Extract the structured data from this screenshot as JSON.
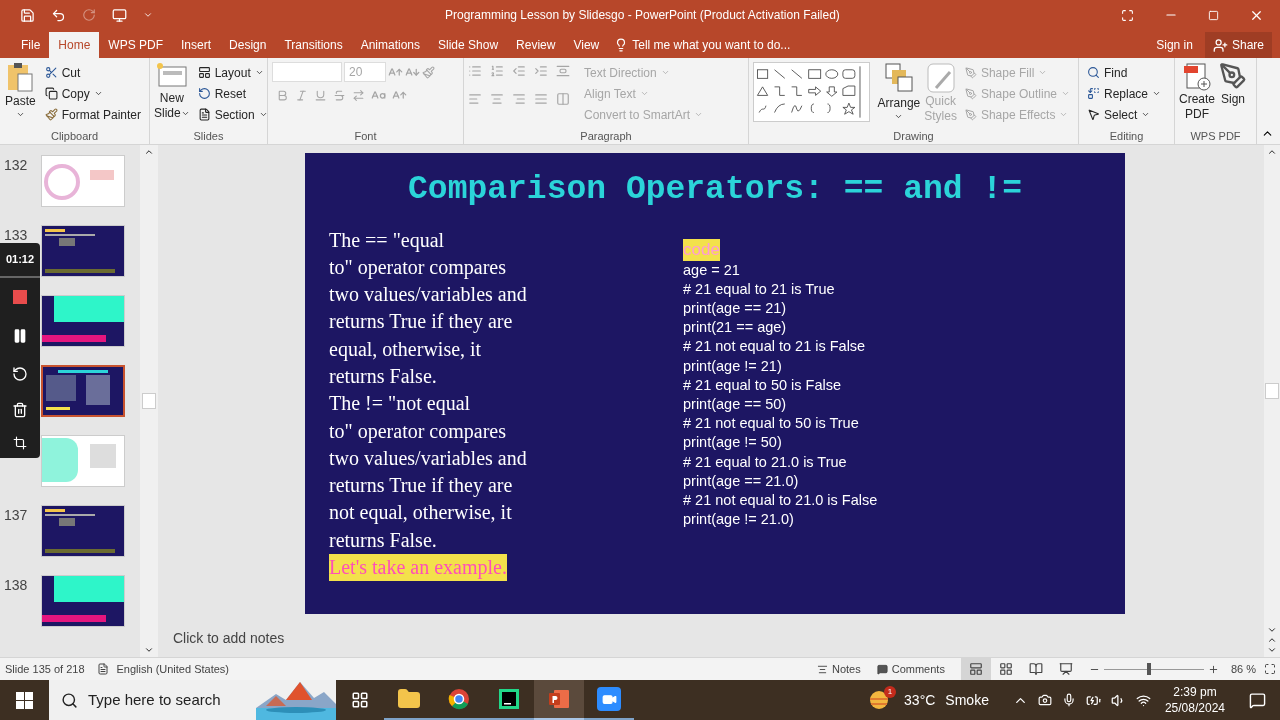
{
  "window": {
    "title": "Programming Lesson by Slidesgo - PowerPoint (Product Activation Failed)"
  },
  "menu_tabs": [
    {
      "label": "File",
      "selected": false
    },
    {
      "label": "Home",
      "selected": true
    },
    {
      "label": "WPS PDF",
      "selected": false
    },
    {
      "label": "Insert",
      "selected": false
    },
    {
      "label": "Design",
      "selected": false
    },
    {
      "label": "Transitions",
      "selected": false
    },
    {
      "label": "Animations",
      "selected": false
    },
    {
      "label": "Slide Show",
      "selected": false
    },
    {
      "label": "Review",
      "selected": false
    },
    {
      "label": "View",
      "selected": false
    }
  ],
  "tell_me": "Tell me what you want to do...",
  "sign_in": "Sign in",
  "share": "Share",
  "ribbon": {
    "clipboard": {
      "label": "Clipboard",
      "paste": "Paste",
      "items": [
        {
          "label": "Cut",
          "disabled": false
        },
        {
          "label": "Copy",
          "disabled": false
        },
        {
          "label": "Format Painter",
          "disabled": false
        }
      ]
    },
    "slides": {
      "label": "Slides",
      "new_slide": [
        "New",
        "Slide"
      ],
      "items": [
        {
          "label": "Layout",
          "disabled": false
        },
        {
          "label": "Reset",
          "disabled": false
        },
        {
          "label": "Section",
          "disabled": false
        }
      ]
    },
    "font": {
      "label": "Font",
      "size": "20"
    },
    "paragraph": {
      "label": "Paragraph",
      "items": [
        {
          "label": "Text Direction",
          "disabled": true
        },
        {
          "label": "Align Text",
          "disabled": true
        },
        {
          "label": "Convert to SmartArt",
          "disabled": true
        }
      ]
    },
    "drawing": {
      "label": "Drawing",
      "arrange": "Arrange",
      "quick_styles": [
        "Quick",
        "Styles"
      ],
      "items": [
        {
          "label": "Shape Fill",
          "disabled": true
        },
        {
          "label": "Shape Outline",
          "disabled": true
        },
        {
          "label": "Shape Effects",
          "disabled": true
        }
      ]
    },
    "editing": {
      "label": "Editing",
      "items": [
        {
          "label": "Find",
          "disabled": false
        },
        {
          "label": "Replace",
          "disabled": false
        },
        {
          "label": "Select",
          "disabled": false
        }
      ]
    },
    "wps_pdf": {
      "label": "WPS PDF",
      "create_pdf": [
        "Create",
        "PDF"
      ],
      "sign": "Sign"
    }
  },
  "thumbnails": [
    {
      "number": "132",
      "kind": "light",
      "selected": false
    },
    {
      "number": "133",
      "kind": "quiz",
      "selected": false
    },
    {
      "kind": "thanks",
      "selected": false
    },
    {
      "kind": "code",
      "selected": true
    },
    {
      "kind": "teal",
      "selected": false
    },
    {
      "number": "137",
      "kind": "quiz",
      "selected": false
    },
    {
      "number": "138",
      "kind": "thanks",
      "selected": false
    }
  ],
  "recorder": {
    "time": "01:12"
  },
  "slide": {
    "title": "Comparison Operators: == and !=",
    "paragraphs": [
      "The == \"equal\nto\" operator compares\ntwo values/variables and\nreturns True if they are\nequal, otherwise, it\nreturns False.",
      "The != \"not equal\nto\" operator compares\ntwo values/variables and\nreturns True if they are\nnot equal, otherwise, it\nreturns False."
    ],
    "example": "Let's take an example.",
    "code_label": "code",
    "code_lines": [
      "age = 21",
      "# 21 equal to 21 is True",
      "print(age == 21)",
      "print(21 == age)",
      "# 21 not equal to 21 is False",
      "print(age != 21)",
      "# 21 equal to 50 is False",
      "print(age == 50)",
      "# 21 not equal to 50 is True",
      "print(age != 50)",
      "# 21 equal to 21.0 is True",
      "print(age == 21.0)",
      "# 21 not equal to 21.0 is False",
      "print(age != 21.0)"
    ]
  },
  "notes_placeholder": "Click to add notes",
  "status_bar": {
    "slide_info": "Slide 135 of 218",
    "language": "English (United States)",
    "notes": "Notes",
    "comments": "Comments",
    "views": [
      {
        "kind": "normal",
        "selected": true
      },
      {
        "kind": "sorter",
        "selected": false
      },
      {
        "kind": "reading",
        "selected": false
      },
      {
        "kind": "show",
        "selected": false
      }
    ],
    "zoom": {
      "level": 0.45,
      "reading": "86 %"
    }
  },
  "taskbar": {
    "search_placeholder": "Type here to search",
    "apps": [
      {
        "kind": "explorer",
        "selected": false
      },
      {
        "kind": "chrome",
        "selected": false
      },
      {
        "kind": "pycharm",
        "selected": false
      },
      {
        "kind": "powerpoint",
        "selected": true
      },
      {
        "kind": "zoom",
        "selected": false
      }
    ],
    "weather": {
      "badge": "1",
      "temperature": "33°C",
      "condition": "Smoke"
    },
    "time": "2:39 pm",
    "date": "25/08/2024"
  }
}
